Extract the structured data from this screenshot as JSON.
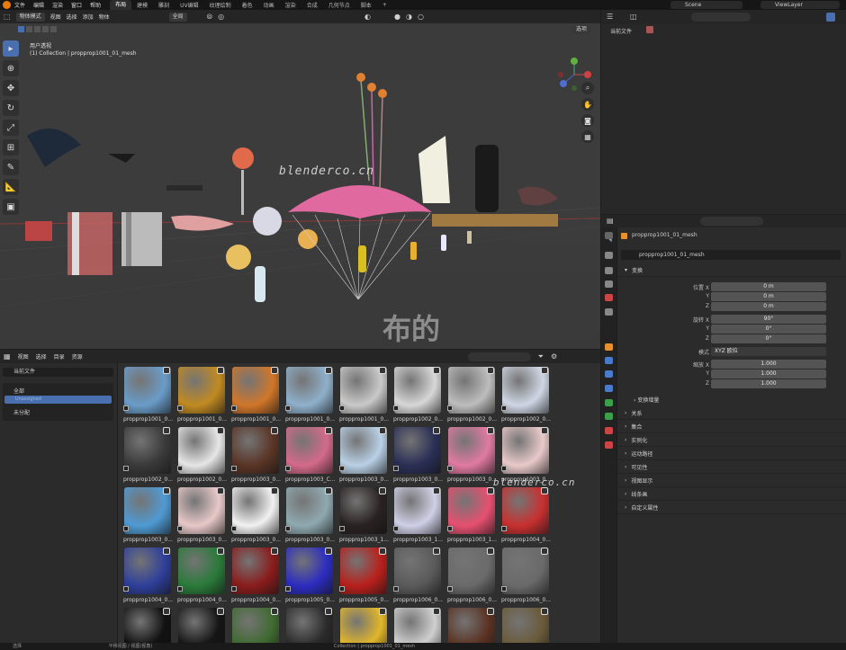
{
  "topbar": {
    "menus": [
      "文件",
      "编辑",
      "渲染",
      "窗口",
      "帮助"
    ],
    "workspaces": [
      "布局",
      "建模",
      "雕刻",
      "UV编辑",
      "纹理绘制",
      "着色",
      "动画",
      "渲染",
      "合成",
      "几何节点",
      "脚本"
    ],
    "active_workspace": "布局",
    "plus": "+",
    "scene": "Scene",
    "view_layer": "ViewLayer"
  },
  "viewport": {
    "mode": "物体模式",
    "menus": [
      "视图",
      "选择",
      "添加",
      "物体"
    ],
    "transform": "全局",
    "view_title": "用户透视",
    "collection_info": "(1) Collection | propprop1001_01_mesh",
    "options": "选项",
    "watermark1": "blenderco.cn",
    "watermark2": "布的",
    "watermark3": "blenderco.cn"
  },
  "outliner": {
    "current_file": "当前文件"
  },
  "properties": {
    "object_name": "propprop1001_01_mesh",
    "mesh_name": "propprop1001_01_mesh",
    "section_transform": "变换",
    "loc_label": "位置 X",
    "loc": {
      "x": "0 m",
      "y": "0 m",
      "z": "0 m"
    },
    "rot_label": "旋转 X",
    "rot": {
      "x": "90°",
      "y": "0°",
      "z": "0°"
    },
    "mode_label": "模式",
    "mode_value": "XYZ 欧拉",
    "scale_label": "缩放 X",
    "scale": {
      "x": "1.000",
      "y": "1.000",
      "z": "1.000"
    },
    "axis_y": "Y",
    "axis_z": "Z",
    "delta": "变换增量",
    "sections": [
      "关系",
      "集合",
      "实例化",
      "运动路径",
      "可见性",
      "视图显示",
      "线条画",
      "自定义属性"
    ]
  },
  "asset_browser": {
    "menus": [
      "视图",
      "选择",
      "目录",
      "资源"
    ],
    "library": "当前文件",
    "tree_all": "全部",
    "tree_unassigned": "未分配",
    "selected_catalog": "Unassigned",
    "items": [
      {
        "label": "propprop1001_0...",
        "color": "#6a9cc8"
      },
      {
        "label": "propprop1001_0...",
        "color": "#c18a22"
      },
      {
        "label": "propprop1001_0...",
        "color": "#d0762a"
      },
      {
        "label": "propprop1001_0...",
        "color": "#8fb0cb"
      },
      {
        "label": "propprop1001_0...",
        "color": "#c9c9c9"
      },
      {
        "label": "propprop1002_0...",
        "color": "#d7d7d7"
      },
      {
        "label": "propprop1002_0...",
        "color": "#bdbdbd"
      },
      {
        "label": "propprop1002_0...",
        "color": "#cfd6e4"
      },
      {
        "label": "propprop1002_0...",
        "color": "#3a3a3a"
      },
      {
        "label": "propprop1002_0...",
        "color": "#e6e6e6"
      },
      {
        "label": "propprop1003_0...",
        "color": "#5a3526"
      },
      {
        "label": "propprop1003_C...",
        "color": "#d46a8a"
      },
      {
        "label": "propprop1003_0...",
        "color": "#b9d0e6"
      },
      {
        "label": "propprop1003_0...",
        "color": "#2a2f55"
      },
      {
        "label": "propprop1003_0...",
        "color": "#e07aa0"
      },
      {
        "label": "propprop1003_0...",
        "color": "#e9c9c9"
      },
      {
        "label": "propprop1003_0...",
        "color": "#4f9ad3"
      },
      {
        "label": "propprop1003_0...",
        "color": "#e8c8c8"
      },
      {
        "label": "propprop1003_0...",
        "color": "#f1f1f1"
      },
      {
        "label": "propprop1003_0...",
        "color": "#8fa9b0"
      },
      {
        "label": "propprop1003_1...",
        "color": "#2a2222"
      },
      {
        "label": "propprop1003_1...",
        "color": "#cfcfe6"
      },
      {
        "label": "propprop1003_1...",
        "color": "#e65070"
      },
      {
        "label": "propprop1004_0...",
        "color": "#c83030"
      },
      {
        "label": "propprop1004_0...",
        "color": "#2e3f9a"
      },
      {
        "label": "propprop1004_0...",
        "color": "#2a7a3a"
      },
      {
        "label": "propprop1004_0...",
        "color": "#8a1c1c"
      },
      {
        "label": "propprop1005_0...",
        "color": "#2c2cc0"
      },
      {
        "label": "propprop1005_0...",
        "color": "#b8201c"
      },
      {
        "label": "propprop1006_0...",
        "color": "#5a5a5a"
      },
      {
        "label": "propprop1006_0...",
        "color": "#6a6a6a"
      },
      {
        "label": "propprop1006_0...",
        "color": "#6a6a6a"
      },
      {
        "label": "",
        "color": "#111111"
      },
      {
        "label": "",
        "color": "#151515"
      },
      {
        "label": "",
        "color": "#3f6a30"
      },
      {
        "label": "",
        "color": "#2a2a2a"
      },
      {
        "label": "",
        "color": "#e0b62a"
      },
      {
        "label": "",
        "color": "#cfcfcf"
      },
      {
        "label": "",
        "color": "#5a3222"
      },
      {
        "label": "",
        "color": "#6a5a3a"
      }
    ]
  },
  "statusbar": {
    "left": "选择",
    "middle": "平移视图 / 视图(视角)",
    "right": "Collection | propprop1001_01_mesh"
  }
}
